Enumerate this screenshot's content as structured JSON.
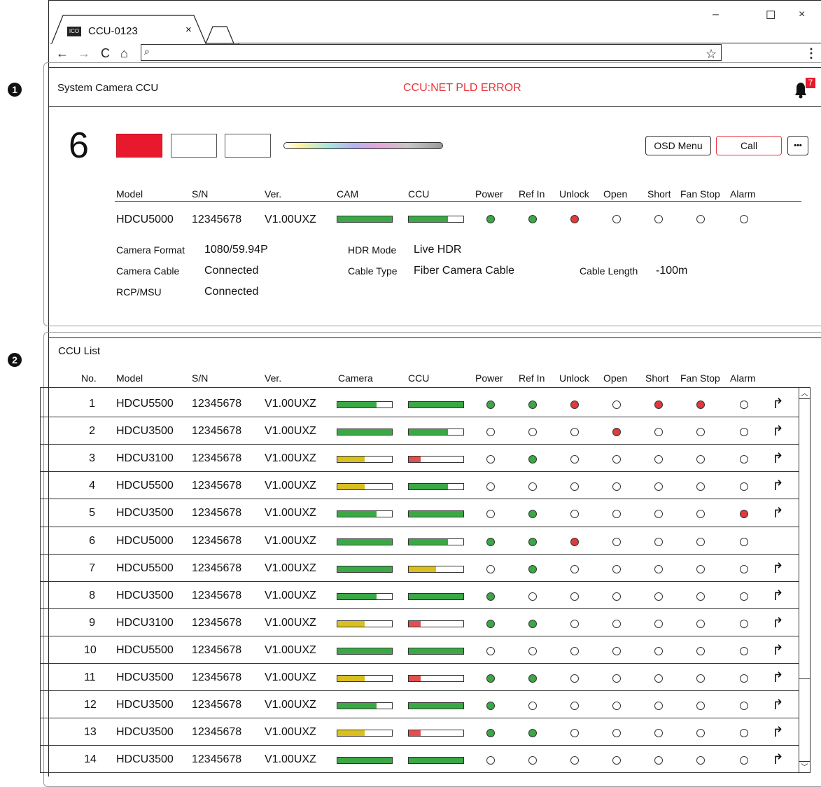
{
  "callouts": [
    "1",
    "2"
  ],
  "browser": {
    "tab_icon": "ICO",
    "tab_title": "CCU-0123",
    "tab_close": "×",
    "minimize": "–",
    "maximize": "☐",
    "close": "×",
    "back": "←",
    "forward": "→",
    "reload": "C",
    "home": "⌂",
    "search_glyph": "⌕",
    "star": "☆",
    "menu": "⋮"
  },
  "header": {
    "title": "System Camera CCU",
    "error": "CCU:NET PLD ERROR",
    "notification_count": "7"
  },
  "detail": {
    "number": "6",
    "buttons": {
      "osd": "OSD Menu",
      "call": "Call",
      "more": "•••"
    },
    "columns": [
      "Model",
      "S/N",
      "Ver.",
      "CAM",
      "CCU",
      "Power",
      "Ref In",
      "Unlock",
      "Open",
      "Short",
      "Fan Stop",
      "Alarm"
    ],
    "model": "HDCU5000",
    "sn": "12345678",
    "ver": "V1.00UXZ",
    "cam": {
      "level": 1.0,
      "color": "#3aa845"
    },
    "ccu": {
      "level": 0.72,
      "color": "#3aa845"
    },
    "status": [
      "green",
      "green",
      "red",
      "off",
      "off",
      "off",
      "off"
    ],
    "info": {
      "camera_format_label": "Camera Format",
      "camera_format": "1080/59.94P",
      "hdr_mode_label": "HDR Mode",
      "hdr_mode": "Live HDR",
      "camera_cable_label": "Camera Cable",
      "camera_cable": "Connected",
      "cable_type_label": "Cable Type",
      "cable_type": "Fiber Camera Cable",
      "cable_length_label": "Cable Length",
      "cable_length": "-100m",
      "rcp_label": "RCP/MSU",
      "rcp": "Connected"
    }
  },
  "list": {
    "title": "CCU List",
    "columns": [
      "No.",
      "Model",
      "S/N",
      "Ver.",
      "Camera",
      "CCU",
      "Power",
      "Ref In",
      "Unlock",
      "Open",
      "Short",
      "Fan Stop",
      "Alarm"
    ],
    "rows": [
      {
        "no": "1",
        "model": "HDCU5500",
        "sn": "12345678",
        "ver": "V1.00UXZ",
        "cam": [
          0.72,
          "#3aa845"
        ],
        "ccu": [
          1.0,
          "#3aa845"
        ],
        "status": [
          "green",
          "green",
          "red",
          "off",
          "red",
          "red",
          "off"
        ],
        "arrow": true
      },
      {
        "no": "2",
        "model": "HDCU3500",
        "sn": "12345678",
        "ver": "V1.00UXZ",
        "cam": [
          1.0,
          "#3aa845"
        ],
        "ccu": [
          0.72,
          "#3aa845"
        ],
        "status": [
          "off",
          "off",
          "off",
          "red",
          "off",
          "off",
          "off"
        ],
        "arrow": true
      },
      {
        "no": "3",
        "model": "HDCU3100",
        "sn": "12345678",
        "ver": "V1.00UXZ",
        "cam": [
          0.5,
          "#d8c020"
        ],
        "ccu": [
          0.22,
          "#e05050"
        ],
        "status": [
          "off",
          "green",
          "off",
          "off",
          "off",
          "off",
          "off"
        ],
        "arrow": true
      },
      {
        "no": "4",
        "model": "HDCU5500",
        "sn": "12345678",
        "ver": "V1.00UXZ",
        "cam": [
          0.5,
          "#d8c020"
        ],
        "ccu": [
          0.72,
          "#3aa845"
        ],
        "status": [
          "off",
          "off",
          "off",
          "off",
          "off",
          "off",
          "off"
        ],
        "arrow": true
      },
      {
        "no": "5",
        "model": "HDCU3500",
        "sn": "12345678",
        "ver": "V1.00UXZ",
        "cam": [
          0.72,
          "#3aa845"
        ],
        "ccu": [
          1.0,
          "#3aa845"
        ],
        "status": [
          "off",
          "green",
          "off",
          "off",
          "off",
          "off",
          "red"
        ],
        "arrow": true
      },
      {
        "no": "6",
        "model": "HDCU5000",
        "sn": "12345678",
        "ver": "V1.00UXZ",
        "cam": [
          1.0,
          "#3aa845"
        ],
        "ccu": [
          0.72,
          "#3aa845"
        ],
        "status": [
          "green",
          "green",
          "red",
          "off",
          "off",
          "off",
          "off"
        ],
        "arrow": false
      },
      {
        "no": "7",
        "model": "HDCU5500",
        "sn": "12345678",
        "ver": "V1.00UXZ",
        "cam": [
          1.0,
          "#3aa845"
        ],
        "ccu": [
          0.5,
          "#d8c020"
        ],
        "status": [
          "off",
          "green",
          "off",
          "off",
          "off",
          "off",
          "off"
        ],
        "arrow": true
      },
      {
        "no": "8",
        "model": "HDCU3500",
        "sn": "12345678",
        "ver": "V1.00UXZ",
        "cam": [
          0.72,
          "#3aa845"
        ],
        "ccu": [
          1.0,
          "#3aa845"
        ],
        "status": [
          "green",
          "off",
          "off",
          "off",
          "off",
          "off",
          "off"
        ],
        "arrow": true
      },
      {
        "no": "9",
        "model": "HDCU3100",
        "sn": "12345678",
        "ver": "V1.00UXZ",
        "cam": [
          0.5,
          "#d8c020"
        ],
        "ccu": [
          0.22,
          "#e05050"
        ],
        "status": [
          "green",
          "green",
          "off",
          "off",
          "off",
          "off",
          "off"
        ],
        "arrow": true
      },
      {
        "no": "10",
        "model": "HDCU5500",
        "sn": "12345678",
        "ver": "V1.00UXZ",
        "cam": [
          1.0,
          "#3aa845"
        ],
        "ccu": [
          1.0,
          "#3aa845"
        ],
        "status": [
          "off",
          "off",
          "off",
          "off",
          "off",
          "off",
          "off"
        ],
        "arrow": true
      },
      {
        "no": "11",
        "model": "HDCU3500",
        "sn": "12345678",
        "ver": "V1.00UXZ",
        "cam": [
          0.5,
          "#d8c020"
        ],
        "ccu": [
          0.22,
          "#e05050"
        ],
        "status": [
          "green",
          "green",
          "off",
          "off",
          "off",
          "off",
          "off"
        ],
        "arrow": true
      },
      {
        "no": "12",
        "model": "HDCU3500",
        "sn": "12345678",
        "ver": "V1.00UXZ",
        "cam": [
          0.72,
          "#3aa845"
        ],
        "ccu": [
          1.0,
          "#3aa845"
        ],
        "status": [
          "green",
          "off",
          "off",
          "off",
          "off",
          "off",
          "off"
        ],
        "arrow": true
      },
      {
        "no": "13",
        "model": "HDCU3500",
        "sn": "12345678",
        "ver": "V1.00UXZ",
        "cam": [
          0.5,
          "#d8c020"
        ],
        "ccu": [
          0.22,
          "#e05050"
        ],
        "status": [
          "green",
          "green",
          "off",
          "off",
          "off",
          "off",
          "off"
        ],
        "arrow": true
      },
      {
        "no": "14",
        "model": "HDCU3500",
        "sn": "12345678",
        "ver": "V1.00UXZ",
        "cam": [
          1.0,
          "#3aa845"
        ],
        "ccu": [
          1.0,
          "#3aa845"
        ],
        "status": [
          "off",
          "off",
          "off",
          "off",
          "off",
          "off",
          "off"
        ],
        "arrow": true
      }
    ],
    "arrow_glyph": "↱",
    "scroll_up": "︿",
    "scroll_down": "﹀"
  },
  "colors": {
    "green": "#3aa845",
    "red": "#e03a3a",
    "alert": "#e8192c",
    "error_text": "#e8343c"
  }
}
